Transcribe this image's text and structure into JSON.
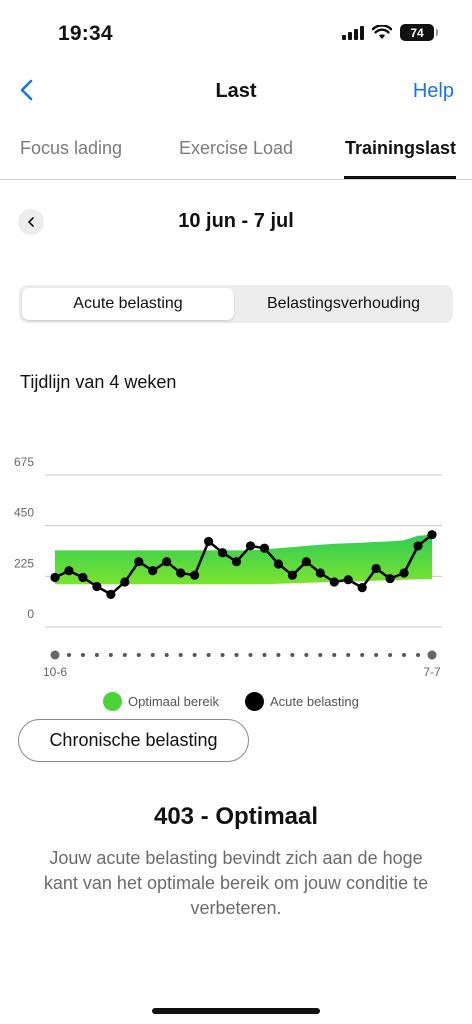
{
  "status_bar": {
    "time": "19:34",
    "battery": "74"
  },
  "nav": {
    "title": "Last",
    "help_label": "Help"
  },
  "tabs": [
    {
      "label": "Focus lading"
    },
    {
      "label": "Exercise Load"
    },
    {
      "label": "Trainingslast"
    }
  ],
  "date_range": {
    "label": "10 jun - 7 jul"
  },
  "segmented": {
    "active_label": "Acute belasting",
    "inactive_label": "Belastingsverhouding"
  },
  "section_title": "Tijdlijn van 4 weken",
  "chart_data": {
    "type": "line",
    "ylim": [
      0,
      675
    ],
    "yticks": [
      "675",
      "450",
      "225",
      "0"
    ],
    "x_start_label": "10-6",
    "x_end_label": "7-7",
    "day_count": 28,
    "optimal_range": {
      "name": "Optimaal bereik",
      "color": "#4cd137",
      "lower": [
        190,
        190,
        190,
        190,
        190,
        190,
        190,
        190,
        190,
        190,
        190,
        190,
        190,
        190,
        190,
        190,
        192,
        194,
        196,
        198,
        200,
        202,
        204,
        206,
        208,
        210,
        212,
        212
      ],
      "upper": [
        340,
        340,
        340,
        340,
        340,
        340,
        340,
        340,
        340,
        340,
        340,
        340,
        340,
        340,
        340,
        345,
        350,
        355,
        360,
        365,
        370,
        372,
        374,
        378,
        380,
        385,
        405,
        410
      ]
    },
    "series": [
      {
        "name": "Acute belasting",
        "color": "#000000",
        "values": [
          220,
          250,
          220,
          180,
          145,
          200,
          290,
          250,
          290,
          240,
          230,
          380,
          330,
          290,
          360,
          350,
          280,
          230,
          290,
          240,
          200,
          210,
          175,
          260,
          215,
          240,
          360,
          410
        ]
      }
    ]
  },
  "legend": {
    "optimal_label": "Optimaal bereik",
    "acute_label": "Acute belasting"
  },
  "chronic_button_label": "Chronische belasting",
  "result": {
    "title": "403 - Optimaal",
    "description": "Jouw acute belasting bevindt zich aan de hoge kant van het optimale bereik om jouw conditie te verbeteren."
  }
}
